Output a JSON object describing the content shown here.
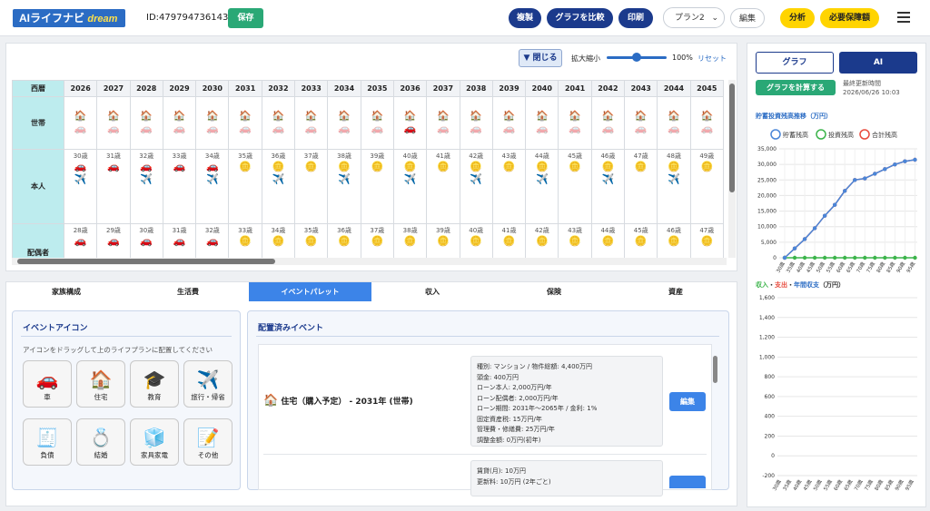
{
  "header": {
    "logo_main": "AIライフナビ",
    "logo_sub": "dream",
    "user_id": "ID:479794736143",
    "save": "保存",
    "duplicate": "複製",
    "compare": "グラフを比較",
    "print": "印刷",
    "plan_select": "プラン2",
    "edit": "編集",
    "analysis": "分析",
    "required_coverage": "必要保障額"
  },
  "toolbar": {
    "close": "▼ 閉じる",
    "zoom_label": "拡大縮小",
    "zoom_value": "100%",
    "reset": "リセット"
  },
  "timeline": {
    "corner": "西暦",
    "years": [
      "2026",
      "2027",
      "2028",
      "2029",
      "2030",
      "2031",
      "2032",
      "2033",
      "2034",
      "2035",
      "2036",
      "2037",
      "2038",
      "2039",
      "2040",
      "2041",
      "2042",
      "2043",
      "2044",
      "2045"
    ],
    "rows": {
      "household": "世帯",
      "self": "本人",
      "spouse": "配偶者"
    },
    "self_ages": [
      "30歳",
      "31歳",
      "32歳",
      "33歳",
      "34歳",
      "35歳",
      "36歳",
      "37歳",
      "38歳",
      "39歳",
      "40歳",
      "41歳",
      "42歳",
      "43歳",
      "44歳",
      "45歳",
      "46歳",
      "47歳",
      "48歳",
      "49歳"
    ],
    "spouse_ages": [
      "28歳",
      "29歳",
      "30歳",
      "31歳",
      "32歳",
      "33歳",
      "34歳",
      "35歳",
      "36歳",
      "37歳",
      "38歳",
      "39歳",
      "40歳",
      "41歳",
      "42歳",
      "43歳",
      "44歳",
      "45歳",
      "46歳",
      "47歳"
    ]
  },
  "tabs": [
    "家族構成",
    "生活費",
    "イベントパレット",
    "収入",
    "保険",
    "資産"
  ],
  "palette": {
    "title": "イベントアイコン",
    "hint": "アイコンをドラッグして上のライフプランに配置してください",
    "icons": [
      {
        "label": "車",
        "icon": "🚗"
      },
      {
        "label": "住宅",
        "icon": "🏠"
      },
      {
        "label": "教育",
        "icon": "🎓"
      },
      {
        "label": "旅行・帰省",
        "icon": "✈️"
      },
      {
        "label": "負債",
        "icon": "🧾"
      },
      {
        "label": "結婚",
        "icon": "💍"
      },
      {
        "label": "家具家電",
        "icon": "🧊"
      },
      {
        "label": "その他",
        "icon": "📝"
      }
    ]
  },
  "placed": {
    "title": "配置済みイベント",
    "event_name": "住宅（購入予定） - 2031年 (世帯)",
    "edit": "編集",
    "details": [
      "種別: マンション / 物件総額: 4,400万円",
      "頭金: 400万円",
      "ローン本人: 2,000万円/年",
      "ローン配偶者: 2,000万円/年",
      "ローン期間: 2031年〜2065年 / 金利: 1%",
      "固定資産税: 15万円/年",
      "管理費・修繕費: 25万円/年",
      "調整金額: 0万円(初年)"
    ],
    "details2": [
      "賃貸(月): 10万円",
      "更新料: 10万円 (2年ごと)"
    ]
  },
  "right": {
    "graph_btn": "グラフ",
    "ai_btn": "AI",
    "calc_btn": "グラフを計算する",
    "updated_label": "最終更新時間",
    "updated_time": "2026/06/26 10:03"
  },
  "chart_data": [
    {
      "type": "line",
      "title": "貯蓄投資残高推移（万円）",
      "x": [
        "30歳",
        "35歳",
        "40歳",
        "45歳",
        "50歳",
        "55歳",
        "60歳",
        "65歳",
        "70歳",
        "75歳",
        "80歳",
        "85歳",
        "90歳",
        "95歳"
      ],
      "series": [
        {
          "name": "貯蓄残高",
          "color": "#4a86d8",
          "values": [
            0,
            3000,
            6000,
            9500,
            13500,
            17000,
            21500,
            25000,
            25500,
            27000,
            28500,
            30000,
            31000,
            31500
          ]
        },
        {
          "name": "投資残高",
          "color": "#3cb44b",
          "values": [
            0,
            0,
            0,
            0,
            0,
            0,
            0,
            0,
            0,
            0,
            0,
            0,
            0,
            0
          ]
        },
        {
          "name": "合計残高",
          "color": "#e84a3c",
          "values": [
            0,
            3000,
            6000,
            9500,
            13500,
            17000,
            21500,
            25000,
            25500,
            27000,
            28500,
            30000,
            31000,
            31500
          ]
        }
      ],
      "ylim": [
        0,
        35000
      ],
      "yticks": [
        "0",
        "5,000",
        "10,000",
        "15,000",
        "20,000",
        "25,000",
        "30,000",
        "35,000"
      ]
    },
    {
      "type": "bar",
      "title_parts": [
        "収入",
        "・",
        "支出",
        "・",
        "年間収支",
        "（万円）"
      ],
      "ylim": [
        -200,
        1600
      ],
      "yticks": [
        "-200",
        "0",
        "200",
        "400",
        "600",
        "800",
        "1,000",
        "1,200",
        "1,400",
        "1,600"
      ],
      "x_labels": [
        "30歳",
        "35歳",
        "40歳",
        "45歳",
        "50歳",
        "55歳",
        "60歳",
        "65歳",
        "70歳",
        "75歳",
        "80歳",
        "85歳",
        "90歳",
        "95歳"
      ]
    }
  ]
}
